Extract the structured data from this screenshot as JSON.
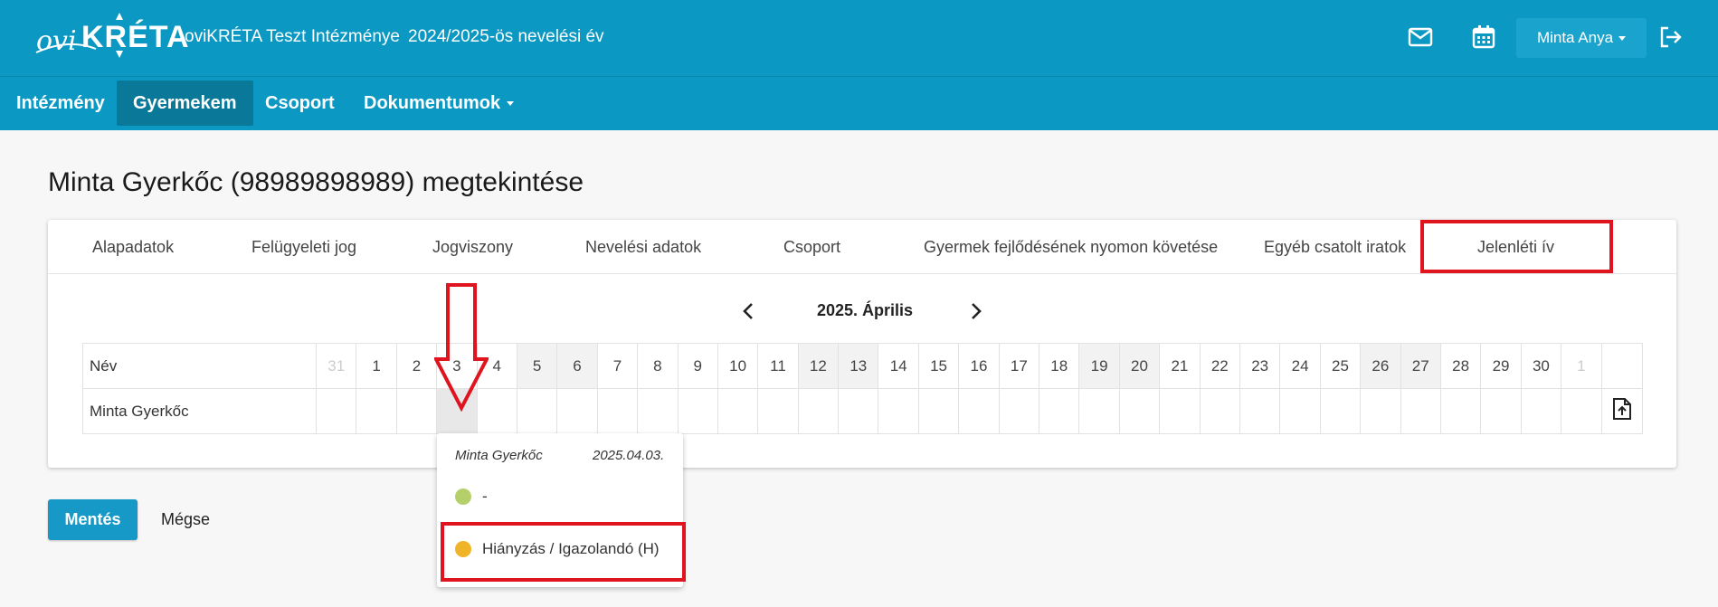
{
  "header": {
    "logo_alt": "oviKRÉTA",
    "institution": "oviKRÉTA Teszt Intézménye",
    "school_year": "2024/2025-ös nevelési év",
    "user": "Minta Anya",
    "icons": [
      "mail-icon",
      "calendar-icon",
      "logout-icon"
    ]
  },
  "nav": [
    {
      "label": "Intézmény"
    },
    {
      "label": "Gyermekem"
    },
    {
      "label": "Csoport"
    },
    {
      "label": "Dokumentumok"
    }
  ],
  "page": {
    "title": "Minta Gyerkőc (98989898989) megtekintése"
  },
  "tabs": [
    {
      "label": "Alapadatok"
    },
    {
      "label": "Felügyeleti jog"
    },
    {
      "label": "Jogviszony"
    },
    {
      "label": "Nevelési adatok"
    },
    {
      "label": "Csoport"
    },
    {
      "label": "Gyermek fejlődésének nyomon követése"
    },
    {
      "label": "Egyéb csatolt iratok"
    },
    {
      "label": "Jelenléti ív"
    }
  ],
  "calendar": {
    "month": "2025. Április",
    "name_header": "Név",
    "days": [
      "31",
      "1",
      "2",
      "3",
      "4",
      "5",
      "6",
      "7",
      "8",
      "9",
      "10",
      "11",
      "12",
      "13",
      "14",
      "15",
      "16",
      "17",
      "18",
      "19",
      "20",
      "21",
      "22",
      "23",
      "24",
      "25",
      "26",
      "27",
      "28",
      "29",
      "30",
      "1"
    ],
    "child": "Minta Gyerkőc"
  },
  "popup": {
    "name": "Minta Gyerkőc",
    "date": "2025.04.03.",
    "options": [
      {
        "label": "-",
        "color": "#b5cf6b"
      },
      {
        "label": "Hiányzás / Igazolandó (H)",
        "color": "#f0b429"
      }
    ]
  },
  "actions": {
    "save": "Mentés",
    "cancel": "Mégse"
  },
  "colors": {
    "primary": "#0b98c3",
    "annotation": "#e0141e"
  }
}
